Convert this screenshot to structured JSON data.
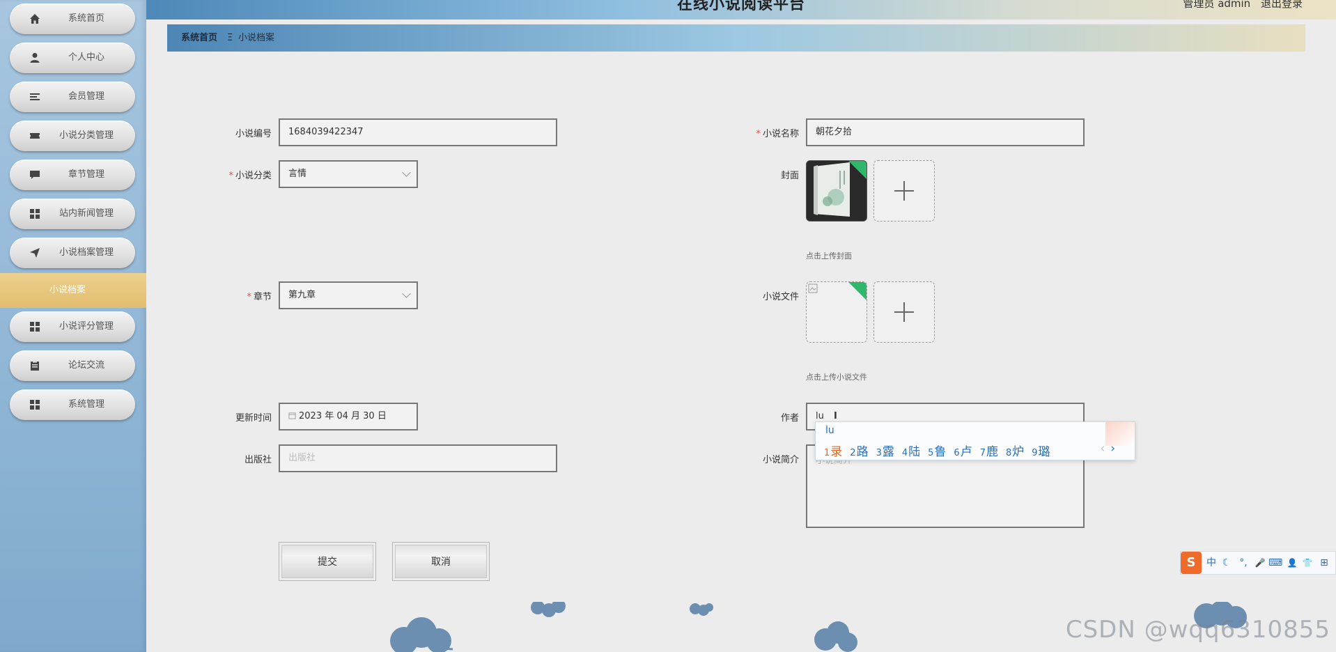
{
  "header": {
    "title": "在线小说阅读平台",
    "user_text": "管理员 admin",
    "logout": "退出登录"
  },
  "sidebar": {
    "items": [
      {
        "label": "系统首页",
        "icon": "home-icon"
      },
      {
        "label": "个人中心",
        "icon": "user-icon"
      },
      {
        "label": "会员管理",
        "icon": "list-icon"
      },
      {
        "label": "小说分类管理",
        "icon": "ticket-icon"
      },
      {
        "label": "章节管理",
        "icon": "chat-icon"
      },
      {
        "label": "站内新闻管理",
        "icon": "grid-icon"
      },
      {
        "label": "小说档案管理",
        "icon": "send-icon"
      },
      {
        "label": "小说评分管理",
        "icon": "grid-icon"
      },
      {
        "label": "论坛交流",
        "icon": "clipboard-icon"
      },
      {
        "label": "系统管理",
        "icon": "grid-icon"
      }
    ],
    "submenu_active": "小说档案"
  },
  "breadcrumb": {
    "home": "系统首页",
    "separator": "Ξ",
    "current": "小说档案"
  },
  "form": {
    "novel_no": {
      "label": "小说编号",
      "value": "1684039422347"
    },
    "novel_name": {
      "label": "小说名称",
      "value": "朝花夕拾"
    },
    "category": {
      "label": "小说分类",
      "value": "言情"
    },
    "cover": {
      "label": "封面",
      "hint": "点击上传封面"
    },
    "chapter": {
      "label": "章节",
      "value": "第九章"
    },
    "file": {
      "label": "小说文件",
      "hint": "点击上传小说文件"
    },
    "update_time": {
      "label": "更新时间",
      "value": "2023 年 04 月 30 日"
    },
    "author": {
      "label": "作者",
      "value": "lu"
    },
    "publisher": {
      "label": "出版社",
      "placeholder": "出版社"
    },
    "intro": {
      "label": "小说简介",
      "placeholder": "小说简介"
    },
    "submit": "提交",
    "cancel": "取消"
  },
  "ime": {
    "composition": "lu",
    "candidates": [
      {
        "n": "1",
        "c": "录"
      },
      {
        "n": "2",
        "c": "路"
      },
      {
        "n": "3",
        "c": "露"
      },
      {
        "n": "4",
        "c": "陆"
      },
      {
        "n": "5",
        "c": "鲁"
      },
      {
        "n": "6",
        "c": "卢"
      },
      {
        "n": "7",
        "c": "鹿"
      },
      {
        "n": "8",
        "c": "炉"
      },
      {
        "n": "9",
        "c": "璐"
      }
    ],
    "prev": "‹",
    "next": "›",
    "toolbar": {
      "logo": "S",
      "mode": "中",
      "moon": "☾",
      "punct": "°,",
      "mic": "🎤",
      "keyboard": "⌨",
      "user": "👤",
      "shirt": "👕",
      "apps": "⊞"
    }
  },
  "watermark": "CSDN @wqq6310855"
}
